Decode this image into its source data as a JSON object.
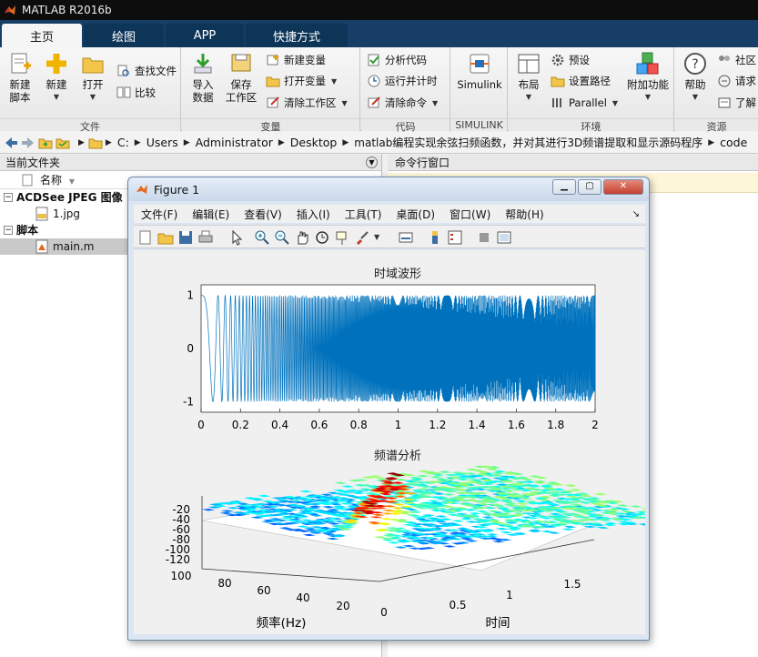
{
  "app": {
    "title": "MATLAB R2016b"
  },
  "tabs": [
    "主页",
    "绘图",
    "APP",
    "快捷方式"
  ],
  "ribbon": {
    "file": {
      "label": "文件",
      "new_script": "新建\n脚本",
      "new": "新建",
      "open": "打开",
      "find_files": "查找文件",
      "compare": "比较"
    },
    "variable": {
      "label": "变量",
      "import": "导入\n数据",
      "save_ws": "保存\n工作区",
      "new_var": "新建变量",
      "open_var": "打开变量",
      "clear_ws": "清除工作区"
    },
    "code": {
      "label": "代码",
      "analyze": "分析代码",
      "run_time": "运行并计时",
      "clear_cmd": "清除命令"
    },
    "simulink": {
      "label": "SIMULINK",
      "btn": "Simulink"
    },
    "env": {
      "label": "环境",
      "layout": "布局",
      "prefs": "预设",
      "set_path": "设置路径",
      "parallel": "Parallel",
      "addons": "附加功能"
    },
    "resources": {
      "label": "资源",
      "help": "帮助",
      "community": "社区",
      "request": "请求",
      "learn": "了解"
    }
  },
  "address": {
    "crumbs": [
      "C:",
      "Users",
      "Administrator",
      "Desktop",
      "matlab编程实现余弦扫频函数，并对其进行3D频谱提取和显示源码程序",
      "code"
    ]
  },
  "files_panel": {
    "title": "当前文件夹",
    "name_col": "名称",
    "groups": [
      {
        "label": "ACDSee JPEG 图像",
        "items": [
          "1.jpg"
        ]
      },
      {
        "label": "脚本",
        "items": [
          "main.m"
        ]
      }
    ]
  },
  "cmd_panel": {
    "title": "命令行窗口"
  },
  "figure": {
    "title": "Figure 1",
    "menu": [
      "文件(F)",
      "编辑(E)",
      "查看(V)",
      "插入(I)",
      "工具(T)",
      "桌面(D)",
      "窗口(W)",
      "帮助(H)"
    ],
    "plot1": {
      "title": "时域波形",
      "xticks": [
        "0",
        "0.2",
        "0.4",
        "0.6",
        "0.8",
        "1",
        "1.2",
        "1.4",
        "1.6",
        "1.8",
        "2"
      ],
      "yticks": [
        "1",
        "0",
        "-1"
      ],
      "color": "#0072bd"
    },
    "plot2": {
      "title": "频谱分析",
      "zticks": [
        "-20",
        "-40",
        "-60",
        "-80",
        "-100",
        "-120"
      ],
      "freq_ticks": [
        "100",
        "80",
        "60",
        "40",
        "20",
        "0"
      ],
      "time_ticks": [
        "0.5",
        "1",
        "1.5"
      ],
      "xlabel": "频率(Hz)",
      "ylabel": "时间"
    }
  },
  "colors": {
    "titlebar": "#0d0d0d",
    "tabs": "#163e66",
    "accent": "#0072bd"
  }
}
